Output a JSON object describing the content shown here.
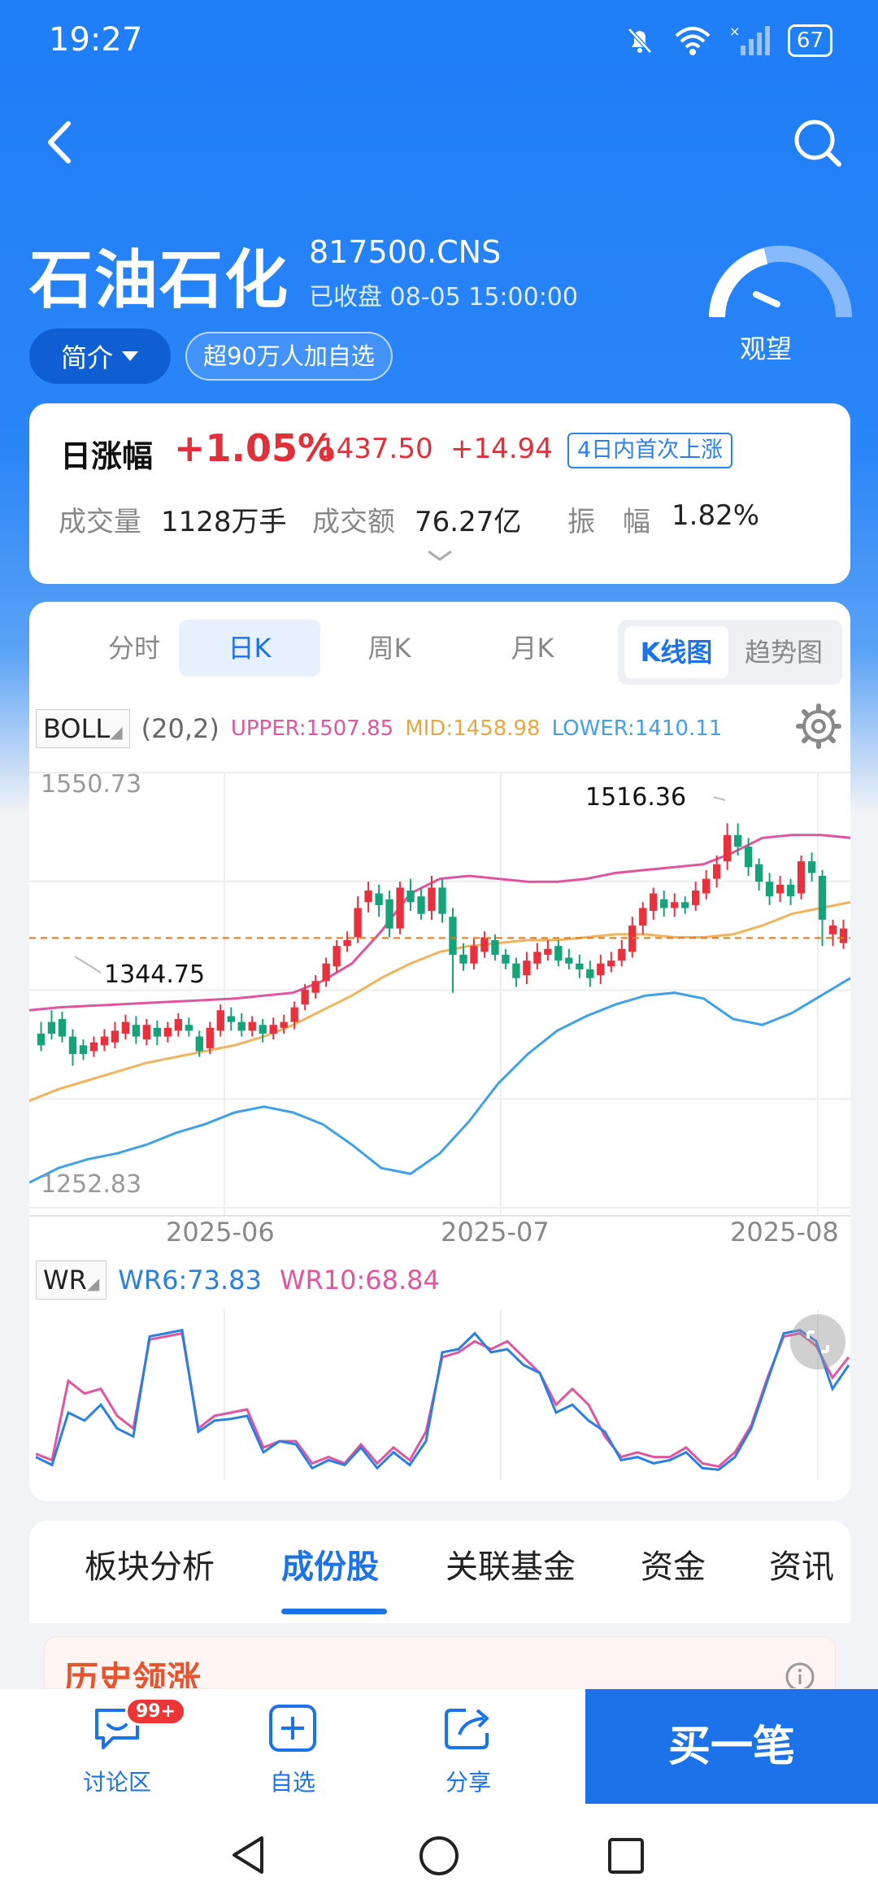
{
  "status_bar": {
    "time": "19:27",
    "battery": "67"
  },
  "stock": {
    "name": "石油石化",
    "code": "817500.CNS",
    "status": "已收盘  08-05 15:00:00",
    "intro_label": "简介",
    "follow_label": "超90万人加自选",
    "sentiment": "观望"
  },
  "daily": {
    "title": "日涨幅",
    "pct": "+1.05%",
    "price": "1437.50",
    "change": "+14.94",
    "tag": "4日内首次上涨",
    "volume_label": "成交量",
    "volume": "1128万手",
    "amount_label": "成交额",
    "amount": "76.27亿",
    "amp_label": "振　幅",
    "amp": "1.82%"
  },
  "chart_tabs": {
    "items": [
      "分时",
      "日K",
      "周K",
      "月K"
    ],
    "active": "日K",
    "switch": [
      "K线图",
      "趋势图"
    ],
    "switch_active": "K线图"
  },
  "boll": {
    "name": "BOLL",
    "param": "(20,2)",
    "upper": "UPPER:1507.85",
    "mid": "MID:1458.98",
    "lower": "LOWER:1410.11",
    "colors": {
      "upper": "#e0559d",
      "mid": "#f0b45f",
      "lower": "#41a1e8",
      "up": "#e7323e",
      "down": "#16a37a"
    }
  },
  "wr": {
    "name": "WR",
    "wr6": "WR6:73.83",
    "wr10": "WR10:68.84",
    "colors": {
      "wr6": "#2a7fe0",
      "wr10": "#e0559d"
    }
  },
  "chart_data": {
    "type": "candlestick",
    "ylim": [
      1252.83,
      1550.73
    ],
    "y_top_label": "1550.73",
    "y_bottom_label": "1252.83",
    "max_label": "1516.36",
    "min_label": "1344.75",
    "last_close": 1437.5,
    "x_labels": [
      "2025-06",
      "2025-07",
      "2025-08"
    ],
    "candles": [
      [
        1372,
        1364,
        1380,
        1360
      ],
      [
        1380,
        1372,
        1388,
        1368
      ],
      [
        1382,
        1370,
        1387,
        1366
      ],
      [
        1370,
        1358,
        1375,
        1350
      ],
      [
        1364,
        1358,
        1368,
        1354
      ],
      [
        1360,
        1366,
        1370,
        1356
      ],
      [
        1364,
        1370,
        1375,
        1360
      ],
      [
        1366,
        1374,
        1380,
        1362
      ],
      [
        1372,
        1380,
        1385,
        1368
      ],
      [
        1378,
        1370,
        1384,
        1365
      ],
      [
        1368,
        1378,
        1382,
        1364
      ],
      [
        1376,
        1370,
        1381,
        1364
      ],
      [
        1370,
        1376,
        1380,
        1366
      ],
      [
        1374,
        1382,
        1386,
        1370
      ],
      [
        1378,
        1374,
        1383,
        1370
      ],
      [
        1370,
        1360,
        1374,
        1356
      ],
      [
        1362,
        1376,
        1380,
        1358
      ],
      [
        1374,
        1388,
        1392,
        1370
      ],
      [
        1384,
        1380,
        1390,
        1374
      ],
      [
        1380,
        1374,
        1386,
        1370
      ],
      [
        1374,
        1380,
        1384,
        1370
      ],
      [
        1378,
        1372,
        1382,
        1366
      ],
      [
        1372,
        1378,
        1383,
        1368
      ],
      [
        1376,
        1380,
        1385,
        1372
      ],
      [
        1380,
        1390,
        1394,
        1375
      ],
      [
        1392,
        1402,
        1406,
        1388
      ],
      [
        1400,
        1408,
        1412,
        1396
      ],
      [
        1408,
        1420,
        1424,
        1404
      ],
      [
        1418,
        1432,
        1436,
        1414
      ],
      [
        1432,
        1436,
        1442,
        1428
      ],
      [
        1438,
        1458,
        1466,
        1434
      ],
      [
        1462,
        1470,
        1476,
        1455
      ],
      [
        1468,
        1460,
        1474,
        1452
      ],
      [
        1464,
        1444,
        1470,
        1438
      ],
      [
        1444,
        1472,
        1476,
        1440
      ],
      [
        1470,
        1462,
        1478,
        1456
      ],
      [
        1466,
        1454,
        1472,
        1450
      ],
      [
        1456,
        1472,
        1480,
        1450
      ],
      [
        1472,
        1454,
        1478,
        1448
      ],
      [
        1452,
        1426,
        1458,
        1400
      ],
      [
        1426,
        1420,
        1434,
        1415
      ],
      [
        1420,
        1432,
        1438,
        1416
      ],
      [
        1428,
        1438,
        1442,
        1424
      ],
      [
        1436,
        1426,
        1440,
        1422
      ],
      [
        1426,
        1420,
        1430,
        1416
      ],
      [
        1420,
        1410,
        1424,
        1404
      ],
      [
        1412,
        1422,
        1428,
        1406
      ],
      [
        1420,
        1428,
        1434,
        1416
      ],
      [
        1426,
        1430,
        1436,
        1422
      ],
      [
        1432,
        1422,
        1436,
        1418
      ],
      [
        1424,
        1420,
        1430,
        1416
      ],
      [
        1420,
        1416,
        1426,
        1410
      ],
      [
        1416,
        1410,
        1422,
        1404
      ],
      [
        1412,
        1420,
        1426,
        1406
      ],
      [
        1418,
        1422,
        1428,
        1414
      ],
      [
        1422,
        1430,
        1436,
        1418
      ],
      [
        1428,
        1446,
        1452,
        1424
      ],
      [
        1446,
        1458,
        1462,
        1440
      ],
      [
        1456,
        1468,
        1472,
        1450
      ],
      [
        1464,
        1458,
        1470,
        1452
      ],
      [
        1458,
        1462,
        1468,
        1452
      ],
      [
        1462,
        1458,
        1466,
        1454
      ],
      [
        1460,
        1470,
        1476,
        1456
      ],
      [
        1468,
        1478,
        1484,
        1464
      ],
      [
        1478,
        1488,
        1494,
        1472
      ],
      [
        1490,
        1508,
        1516,
        1484
      ],
      [
        1508,
        1500,
        1516,
        1494
      ],
      [
        1500,
        1486,
        1506,
        1480
      ],
      [
        1488,
        1476,
        1492,
        1470
      ],
      [
        1476,
        1466,
        1482,
        1460
      ],
      [
        1468,
        1474,
        1480,
        1462
      ],
      [
        1474,
        1466,
        1478,
        1460
      ],
      [
        1468,
        1490,
        1494,
        1464
      ],
      [
        1490,
        1482,
        1496,
        1476
      ],
      [
        1480,
        1450,
        1484,
        1432
      ],
      [
        1440,
        1446,
        1450,
        1432
      ],
      [
        1434,
        1444,
        1450,
        1430
      ]
    ],
    "boll_upper": [
      1388,
      1390,
      1391,
      1392,
      1393,
      1394,
      1395,
      1396,
      1398,
      1400,
      1408,
      1420,
      1442,
      1468,
      1478,
      1480,
      1478,
      1476,
      1476,
      1478,
      1482,
      1484,
      1486,
      1488,
      1496,
      1506,
      1508,
      1508,
      1506
    ],
    "boll_mid": [
      1326,
      1334,
      1340,
      1346,
      1352,
      1356,
      1360,
      1364,
      1370,
      1378,
      1388,
      1398,
      1410,
      1420,
      1428,
      1432,
      1434,
      1436,
      1436,
      1438,
      1440,
      1440,
      1438,
      1438,
      1440,
      1446,
      1454,
      1458,
      1462
    ],
    "boll_lower": [
      1270,
      1280,
      1286,
      1290,
      1296,
      1304,
      1310,
      1318,
      1322,
      1318,
      1310,
      1296,
      1280,
      1276,
      1290,
      1312,
      1338,
      1358,
      1374,
      1384,
      1392,
      1398,
      1400,
      1396,
      1382,
      1378,
      1386,
      1398,
      1410
    ],
    "wr6": [
      88,
      93,
      60,
      65,
      55,
      70,
      75,
      12,
      10,
      8,
      72,
      65,
      64,
      62,
      85,
      78,
      80,
      95,
      90,
      93,
      82,
      95,
      85,
      93,
      78,
      22,
      20,
      10,
      22,
      20,
      30,
      35,
      60,
      55,
      65,
      72,
      90,
      88,
      92,
      90,
      85,
      95,
      96,
      88,
      70,
      40,
      10,
      8,
      15,
      45,
      30
    ],
    "wr10": [
      86,
      90,
      40,
      48,
      45,
      62,
      70,
      14,
      12,
      10,
      70,
      62,
      60,
      58,
      82,
      78,
      78,
      92,
      88,
      92,
      80,
      92,
      82,
      90,
      72,
      25,
      22,
      15,
      20,
      15,
      25,
      35,
      55,
      45,
      55,
      75,
      88,
      85,
      88,
      88,
      82,
      92,
      94,
      85,
      68,
      38,
      12,
      10,
      18,
      38,
      25
    ]
  },
  "sector_tabs": {
    "items": [
      "板块分析",
      "成份股",
      "关联基金",
      "资金",
      "资讯"
    ],
    "active": "成份股"
  },
  "history": {
    "title": "历史领涨"
  },
  "bottom_bar": {
    "discuss": "讨论区",
    "badge": "99+",
    "watch": "自选",
    "share": "分享",
    "buy": "买一笔"
  }
}
